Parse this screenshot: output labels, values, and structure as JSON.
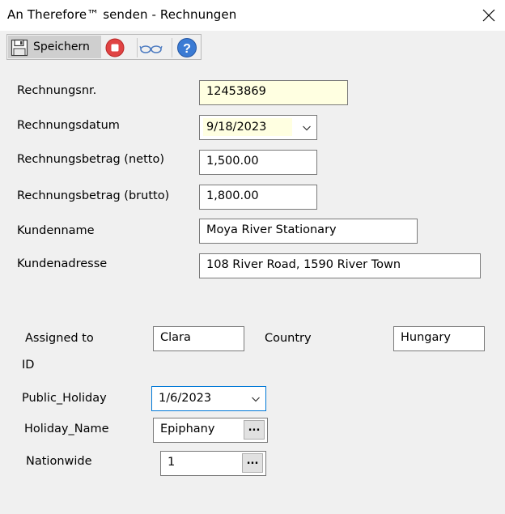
{
  "window": {
    "title": "An Therefore™ senden - Rechnungen"
  },
  "toolbar": {
    "save_label": "Speichern",
    "icons": [
      "save-icon",
      "stop-icon",
      "glasses-icon",
      "help-icon"
    ]
  },
  "form": {
    "invoice_number": {
      "label": "Rechnungsnr.",
      "value": "12453869"
    },
    "invoice_date": {
      "label": "Rechnungsdatum",
      "value": "9/18/2023"
    },
    "amount_net": {
      "label": "Rechnungsbetrag (netto)",
      "value": "1,500.00"
    },
    "amount_gross": {
      "label": "Rechnungsbetrag (brutto)",
      "value": "1,800.00"
    },
    "customer_name": {
      "label": "Kundenname",
      "value": "Moya River Stationary"
    },
    "customer_address": {
      "label": "Kundenadresse",
      "value": "108 River Road, 1590 River Town"
    }
  },
  "lower": {
    "assigned_to": {
      "label": "Assigned to",
      "value": "Clara"
    },
    "country": {
      "label": "Country",
      "value": "Hungary"
    },
    "id_label": "ID",
    "public_holiday": {
      "label": "Public_Holiday",
      "value": "1/6/2023"
    },
    "holiday_name": {
      "label": "Holiday_Name",
      "value": "Epiphany",
      "button": "..."
    },
    "nationwide": {
      "label": "Nationwide",
      "value": "1",
      "button": "..."
    }
  },
  "colors": {
    "highlight_field": "#ffffe1",
    "focus_border": "#0078d7",
    "stop_red": "#e04343",
    "help_blue": "#3b7bd4"
  }
}
